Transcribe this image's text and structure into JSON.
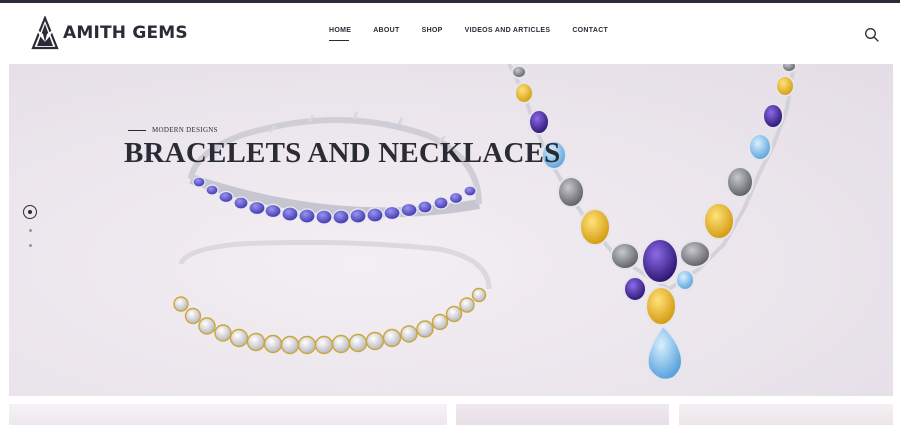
{
  "brand": {
    "name": "AMITH GEMS",
    "logo_icon": "gem-star-logo"
  },
  "nav": {
    "items": [
      {
        "label": "HOME",
        "active": true
      },
      {
        "label": "ABOUT",
        "active": false
      },
      {
        "label": "SHOP",
        "active": false
      },
      {
        "label": "VIDEOS AND ARTICLES",
        "active": false
      },
      {
        "label": "CONTACT",
        "active": false
      }
    ],
    "search_icon": "search-icon"
  },
  "hero": {
    "eyebrow": "MODERN DESIGNS",
    "title": "BRACELETS AND NECKLACES",
    "slides": {
      "count": 3,
      "active": 1
    }
  },
  "colors": {
    "text": "#2b2b36",
    "hero_bg": "#ebe5ec",
    "tanzanite": "#5a52c8",
    "citrine": "#e3b21f",
    "amethyst": "#4a2a9a",
    "blue_topaz": "#7ab8e6",
    "smoky_quartz": "#7e7f84"
  }
}
